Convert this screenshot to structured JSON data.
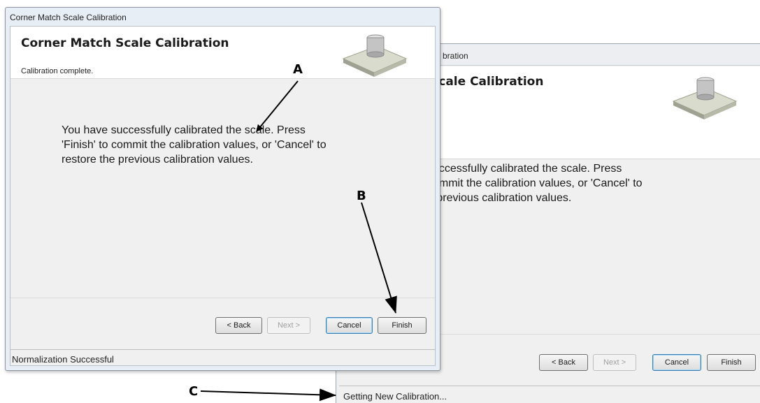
{
  "back_window": {
    "title_fragment": "bration",
    "header_title_fragment": "Scale Calibration",
    "body_lines": [
      "successfully calibrated the scale. Press",
      "commit the calibration values, or 'Cancel' to",
      "e previous calibration values."
    ],
    "buttons": {
      "back": "< Back",
      "next": "Next >",
      "cancel": "Cancel",
      "finish": "Finish"
    },
    "status_text": "Getting New Calibration..."
  },
  "front_window": {
    "title": "Corner Match Scale Calibration",
    "header_title": "Corner Match Scale Calibration",
    "header_subtitle": "Calibration complete.",
    "body_lines": [
      "You have successfully calibrated the scale. Press",
      "'Finish' to commit the calibration values, or 'Cancel' to",
      "restore the previous calibration values."
    ],
    "buttons": {
      "back": "< Back",
      "next": "Next >",
      "cancel": "Cancel",
      "finish": "Finish"
    },
    "status_text": "Normalization Successful"
  },
  "callouts": {
    "a": "A",
    "b": "B",
    "c": "C"
  },
  "colors": {
    "callout": "#000000",
    "default_button_border": "#3c7fb1"
  },
  "icons": {
    "header_graphic": "platform-scale-icon"
  }
}
